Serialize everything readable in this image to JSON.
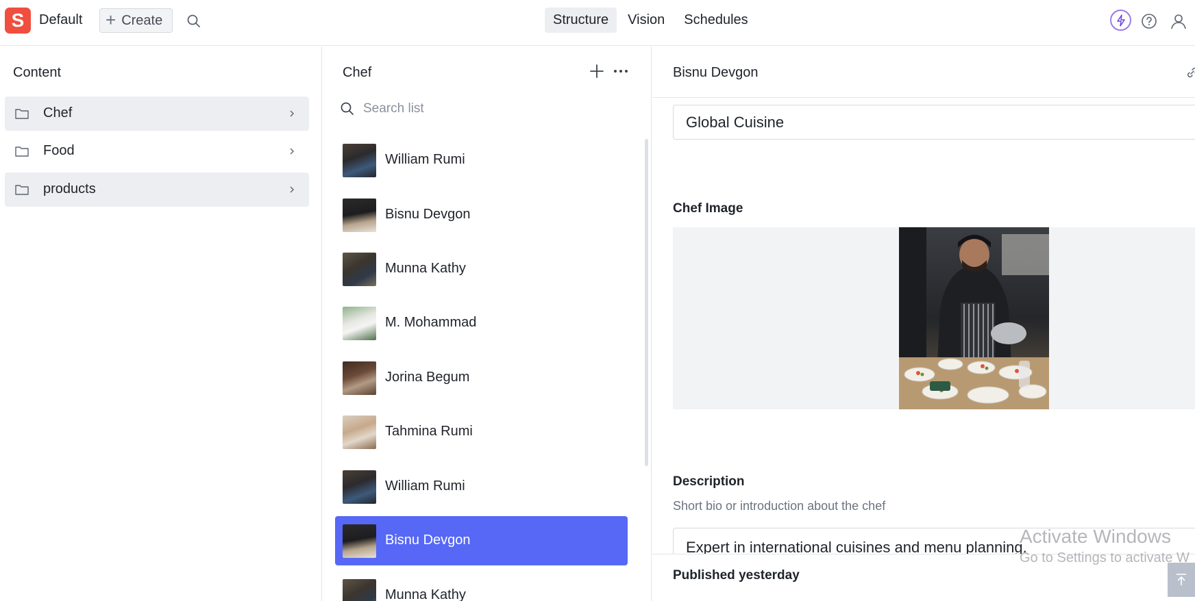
{
  "app": {
    "logo_letter": "S",
    "workspace": "Default",
    "create_label": "Create",
    "nav": [
      "Structure",
      "Vision",
      "Schedules"
    ],
    "active_nav": "Structure",
    "brand_color": "#f04e3e",
    "accent_color": "#5668f5"
  },
  "content_pane": {
    "title": "Content",
    "items": [
      {
        "label": "Chef",
        "icon": "folder-icon",
        "selected": true
      },
      {
        "label": "Food",
        "icon": "folder-icon",
        "selected": false
      },
      {
        "label": "products",
        "icon": "folder-icon",
        "selected": false
      }
    ]
  },
  "chef_pane": {
    "title": "Chef",
    "search_placeholder": "Search list",
    "items": [
      {
        "name": "William Rumi",
        "selected": false
      },
      {
        "name": "Bisnu Devgon",
        "selected": false
      },
      {
        "name": "Munna Kathy",
        "selected": false
      },
      {
        "name": "M. Mohammad",
        "selected": false
      },
      {
        "name": "Jorina Begum",
        "selected": false
      },
      {
        "name": "Tahmina Rumi",
        "selected": false
      },
      {
        "name": "William Rumi",
        "selected": false
      },
      {
        "name": "Bisnu Devgon",
        "selected": true
      },
      {
        "name": "Munna Kathy",
        "selected": false
      }
    ]
  },
  "document": {
    "title": "Bisnu Devgon",
    "specialty_value": "Global Cuisine",
    "image_label": "Chef Image",
    "description_label": "Description",
    "description_help": "Short bio or introduction about the chef",
    "description_value": "Expert in international cuisines and menu planning.",
    "status": "Published yesterday"
  },
  "watermark": {
    "line1": "Activate Windows",
    "line2": "Go to Settings to activate W"
  }
}
